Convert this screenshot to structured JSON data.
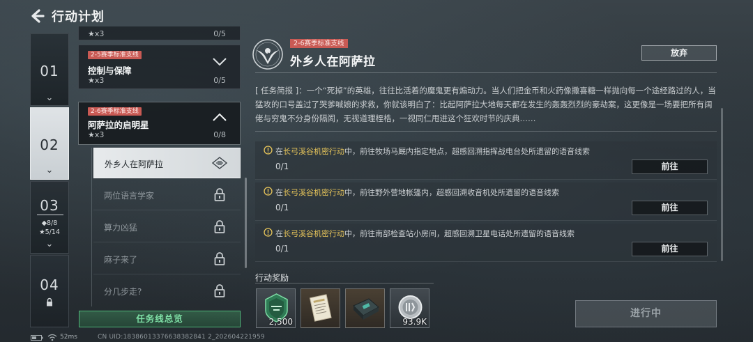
{
  "header": {
    "title": "行动计划"
  },
  "chapters": [
    {
      "number": "01"
    },
    {
      "number": "02"
    },
    {
      "number": "03",
      "stat_diamond": "◆8/8",
      "stat_star": "★5/14"
    },
    {
      "number": "04"
    }
  ],
  "missions": {
    "top_partial": {
      "stars": "★x3",
      "progress": "0/5"
    },
    "control": {
      "tag": "2-5赛季标准支线",
      "name": "控制与保障",
      "stars": "★x3",
      "progress": "0/5"
    },
    "expanded": {
      "tag": "2-6赛季标准支线",
      "name": "阿萨拉的启明星",
      "stars": "★x3",
      "progress": "0/8"
    },
    "sub_items": [
      {
        "label": "外乡人在阿萨拉"
      },
      {
        "label": "两位语言学家"
      },
      {
        "label": "算力凶猛"
      },
      {
        "label": "麻子来了"
      },
      {
        "label": "分几步走?"
      }
    ],
    "overview_label": "任务线总览"
  },
  "detail": {
    "tag": "2-6赛季标准支线",
    "title": "外乡人在阿萨拉",
    "abandon_label": "放弃",
    "brief": "[ 任务简报 ]：一个“死掉”的英雄，往往比活着的魔鬼更有煽动力。当人们把金币和火药像撒喜糖一样抛向每一个途经路过的人，当猛攻的口号盖过了哭爹喊娘的求救，你就该明白了：比起阿萨拉大地每天都在发生的轰轰烈烈的豪劫案，这更像是一场要把所有阔佬与穷鬼不分身份隔阂，无视道理桎梏，一视同仁甩进这个狂欢时节的庆典……",
    "objectives": [
      {
        "highlight": "长弓溪谷机密行动",
        "prefix": "在",
        "text": "中，前往牧场马厩内指定地点，超感回溯指挥战电台处所遗留的语音线索",
        "progress": "0/1",
        "button": "前往"
      },
      {
        "highlight": "长弓溪谷机密行动",
        "prefix": "在",
        "text": "中，前往野外营地帐篷内，超感回溯收音机处所遗留的语音线索",
        "progress": "0/1",
        "button": "前往"
      },
      {
        "highlight": "长弓溪谷机密行动",
        "prefix": "在",
        "text": "中，前往南部检查站小房间，超感回溯卫星电话处所遗留的语音线索",
        "progress": "0/1",
        "button": "前往"
      }
    ],
    "rewards_title": "行动奖励",
    "rewards": [
      {
        "icon": "green-badge-icon",
        "qty": "2,500"
      },
      {
        "icon": "document-icon",
        "qty": ""
      },
      {
        "icon": "device-case-icon",
        "qty": ""
      },
      {
        "icon": "silver-coin-icon",
        "qty": "93.9K"
      }
    ],
    "status_button": "进行中"
  },
  "status_bar": {
    "ping": "52ms",
    "uid": "CN UID:18386013376638382841 2_202604221959"
  },
  "colors": {
    "tag_red": "#c95a54",
    "highlight_yellow": "#e6c45a",
    "accent_green": "#4fb87a"
  }
}
